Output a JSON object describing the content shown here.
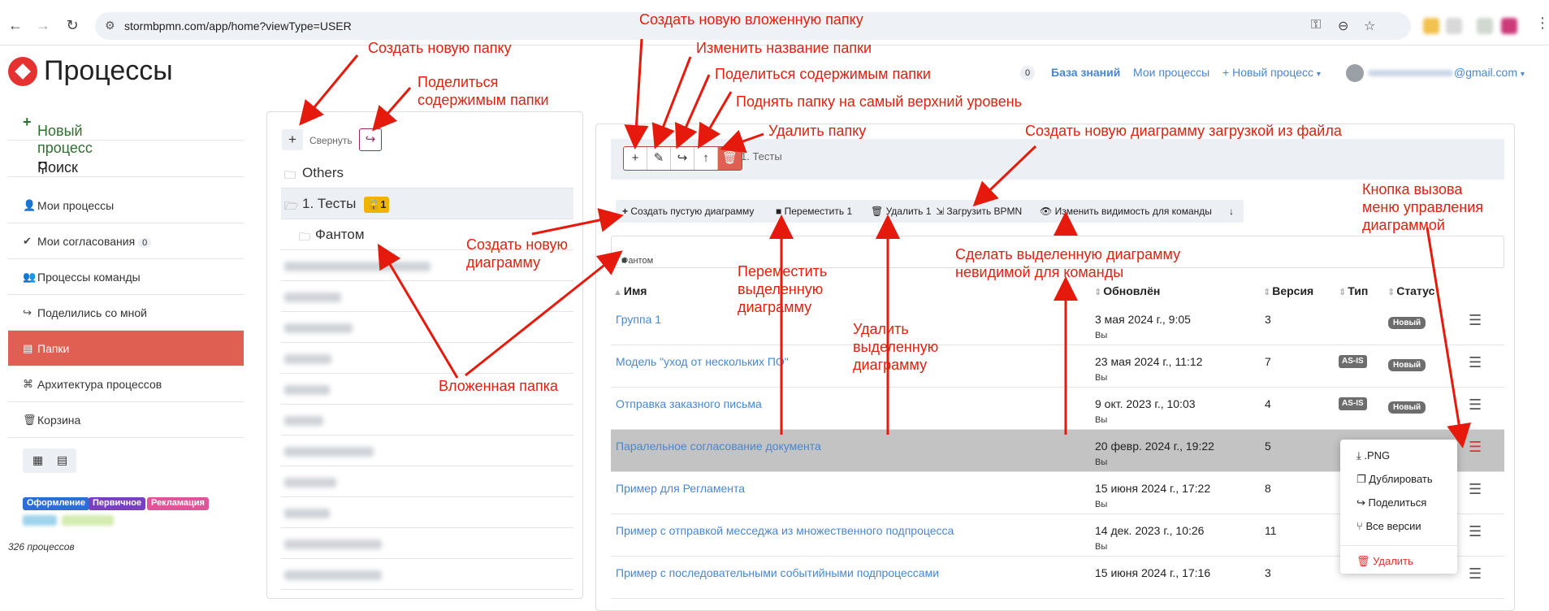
{
  "browser": {
    "url": "stormbpmn.com/app/home?viewType=USER"
  },
  "app": {
    "title": "Процессы"
  },
  "header": {
    "badge": "0",
    "knowledge_base": "База знаний",
    "my_processes": "Мои процессы",
    "new_process": "Новый процесс",
    "email_suffix": "@gmail.com"
  },
  "sidebar": {
    "new_process": "Новый процесс",
    "search": "Поиск",
    "items": [
      {
        "label": "Мои процессы",
        "icon": "user-icon"
      },
      {
        "label": "Мои согласования",
        "icon": "check-circle-icon",
        "badge": "0"
      },
      {
        "label": "Процессы команды",
        "icon": "users-icon"
      },
      {
        "label": "Поделились со мной",
        "icon": "share-icon"
      },
      {
        "label": "Папки",
        "icon": "folder-tree-icon",
        "active": true
      },
      {
        "label": "Архитектура процессов",
        "icon": "sitemap-icon"
      },
      {
        "label": "Корзина",
        "icon": "trash-icon"
      }
    ],
    "tags": [
      {
        "label": "Оформление",
        "color": "#2b6fd6"
      },
      {
        "label": "Первичное",
        "color": "#7a3fc0"
      },
      {
        "label": "Рекламация",
        "color": "#e0559a"
      }
    ],
    "process_count": "326 процессов"
  },
  "folders": {
    "collapse_label": "Свернуть",
    "items": [
      {
        "label": "Others"
      },
      {
        "label": "1. Тесты",
        "lock_count": "1",
        "selected": true
      },
      {
        "label": "Фантом",
        "nested": true
      }
    ]
  },
  "main": {
    "breadcrumb": "1. Тесты",
    "actions": {
      "create_empty": "Создать пустую диаграмму",
      "move": "Переместить 1",
      "delete": "Удалить 1",
      "upload": "Загрузить BPMN",
      "visibility": "Изменить видимость для команды"
    },
    "subfolder": "Фантом",
    "columns": {
      "name": "Имя",
      "updated": "Обновлён",
      "version": "Версия",
      "type": "Тип",
      "status": "Статус"
    },
    "rows": [
      {
        "name": "Группа 1",
        "date": "3 мая 2024 г., 9:05",
        "by": "Вы",
        "version": "3",
        "type": "",
        "status": "Новый"
      },
      {
        "name": "Модель \"уход от нескольких ПО\"",
        "date": "23 мая 2024 г., 11:12",
        "by": "Вы",
        "version": "7",
        "type": "AS-IS",
        "status": "Новый"
      },
      {
        "name": "Отправка заказного письма",
        "date": "9 окт. 2023 г., 10:03",
        "by": "Вы",
        "version": "4",
        "type": "AS-IS",
        "status": "Новый"
      },
      {
        "name": "Паралельное согласование документа",
        "date": "20 февр. 2024 г., 19:22",
        "by": "Вы",
        "version": "5",
        "type": "",
        "status": "",
        "highlighted": true
      },
      {
        "name": "Пример для Регламента",
        "date": "15 июня 2024 г., 17:22",
        "by": "Вы",
        "version": "8",
        "type": "",
        "status": ""
      },
      {
        "name": "Пример с отправкой месседжа из множественного подпроцесса",
        "date": "14 дек. 2023 г., 10:26",
        "by": "Вы",
        "version": "11",
        "type": "",
        "status": ""
      },
      {
        "name": "Пример с последовательными событийными подпроцессами",
        "date": "15 июня 2024 г., 17:16",
        "by": "",
        "version": "3",
        "type": "",
        "status": ""
      }
    ],
    "context_menu": [
      {
        "label": ".PNG",
        "icon": "download-icon"
      },
      {
        "label": "Дублировать",
        "icon": "copy-icon"
      },
      {
        "label": "Поделиться",
        "icon": "share-icon"
      },
      {
        "label": "Все версии",
        "icon": "branch-icon"
      },
      {
        "label": "Удалить",
        "icon": "trash-icon"
      }
    ]
  },
  "annotations": {
    "create_folder": "Создать новую папку",
    "share_folder_1": "Поделиться",
    "share_folder_2": "содержимым папки",
    "create_subfolder": "Создать новую вложенную папку",
    "rename_folder": "Изменить название папки",
    "share_content": "Поделиться содержимым папки",
    "move_top": "Поднять папку на самый верхний уровень",
    "delete_folder": "Удалить папку",
    "upload_new": "Создать новую диаграмму загрузкой из файла",
    "menu_btn_1": "Кнопка вызова",
    "menu_btn_2": "меню управления",
    "menu_btn_3": "диаграммой",
    "create_diagram_1": "Создать новую",
    "create_diagram_2": "диаграмму",
    "move_sel_1": "Переместить",
    "move_sel_2": "выделенную",
    "move_sel_3": "диаграмму",
    "invisible_1": "Сделать выделенную диаграмму",
    "invisible_2": "невидимой для команды",
    "delete_sel_1": "Удалить",
    "delete_sel_2": "выделенную",
    "delete_sel_3": "диаграмму",
    "nested_folder": "Вложенная папка"
  }
}
